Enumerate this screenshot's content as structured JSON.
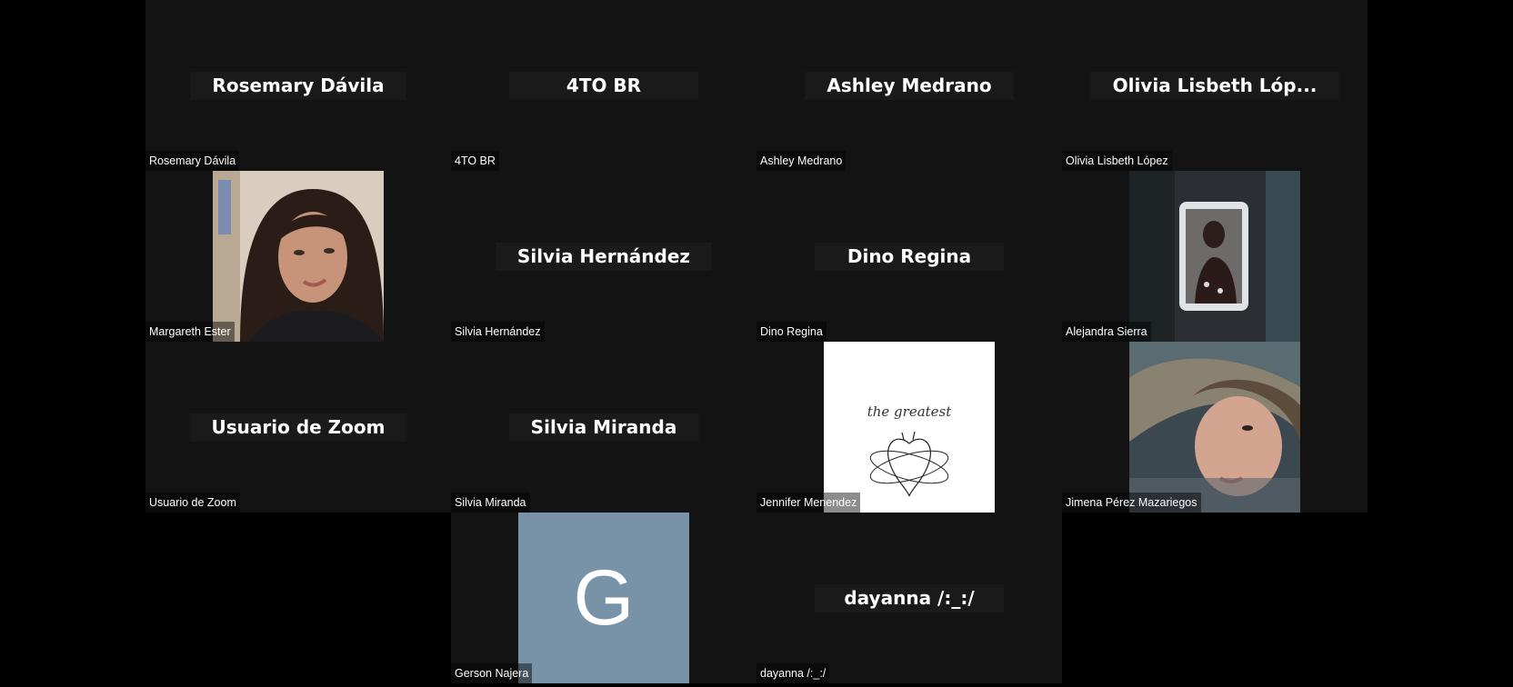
{
  "tiles": [
    {
      "name": "Rosemary Dávila",
      "display": "Rosemary Dávila",
      "type": "text"
    },
    {
      "name": "4TO BR",
      "display": "4TO BR",
      "type": "text"
    },
    {
      "name": "Ashley Medrano",
      "display": "Ashley Medrano",
      "type": "text"
    },
    {
      "name": "Olivia Lisbeth López",
      "display": "Olivia Lisbeth Lóp...",
      "type": "text"
    },
    {
      "name": "Margareth Ester",
      "display": "",
      "type": "photo-selfie"
    },
    {
      "name": "Silvia Hernández",
      "display": "Silvia Hernández",
      "type": "text"
    },
    {
      "name": "Dino Regina",
      "display": "Dino Regina",
      "type": "text"
    },
    {
      "name": "Alejandra Sierra",
      "display": "",
      "type": "photo-mirror"
    },
    {
      "name": "Usuario de Zoom",
      "display": "Usuario de Zoom",
      "type": "text"
    },
    {
      "name": "Silvia Miranda",
      "display": "Silvia Miranda",
      "type": "text"
    },
    {
      "name": "Jennifer Menendez",
      "display": "",
      "type": "photo-art"
    },
    {
      "name": "Jimena Pérez Mazariegos",
      "display": "",
      "type": "photo-hair"
    },
    {
      "name": "Gerson Najera",
      "display": "G",
      "type": "initial"
    },
    {
      "name": "dayanna /:_:/",
      "display": "dayanna /:_:/",
      "type": "text"
    }
  ],
  "art_text": "the greatest",
  "colors": {
    "tile_bg": "#131313",
    "initial_bg": "#7893a7"
  }
}
